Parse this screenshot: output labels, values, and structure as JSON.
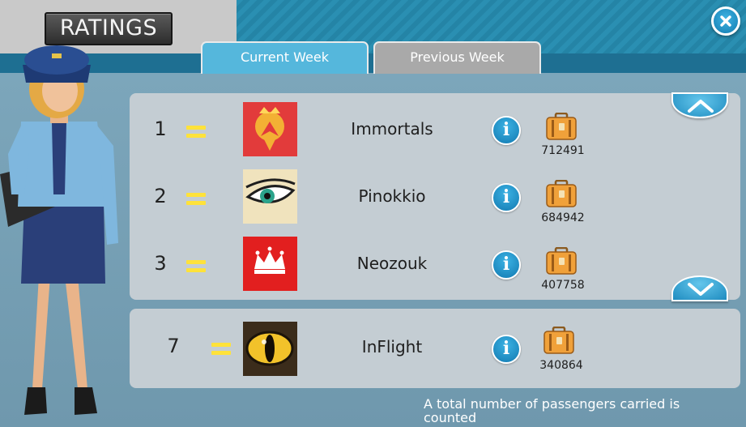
{
  "header": {
    "title": "RATINGS",
    "tabs": [
      {
        "label": "Current Week",
        "active": true
      },
      {
        "label": "Previous Week",
        "active": false
      }
    ]
  },
  "leaderboard": [
    {
      "rank": "1",
      "change": "=",
      "name": "Immortals",
      "score": "712491",
      "logo": "phoenix-crown-logo"
    },
    {
      "rank": "2",
      "change": "=",
      "name": "Pinokkio",
      "score": "684942",
      "logo": "eye-logo"
    },
    {
      "rank": "3",
      "change": "=",
      "name": "Neozouk",
      "score": "407758",
      "logo": "crown-logo"
    }
  ],
  "player_row": {
    "rank": "7",
    "change": "=",
    "name": "InFlight",
    "score": "340864",
    "logo": "cat-eye-logo"
  },
  "footer": {
    "note": "A total number of passengers carried is counted"
  },
  "colors": {
    "accent_blue": "#1e8bbf",
    "equal_marker": "#ffe23a",
    "tab_active": "#55b7dc",
    "tab_inactive": "#a9a9a9"
  },
  "icons": {
    "close": "close-icon",
    "info": "info-icon",
    "suitcase": "suitcase-icon",
    "scroll_up": "chevron-up-icon",
    "scroll_down": "chevron-down-icon"
  }
}
